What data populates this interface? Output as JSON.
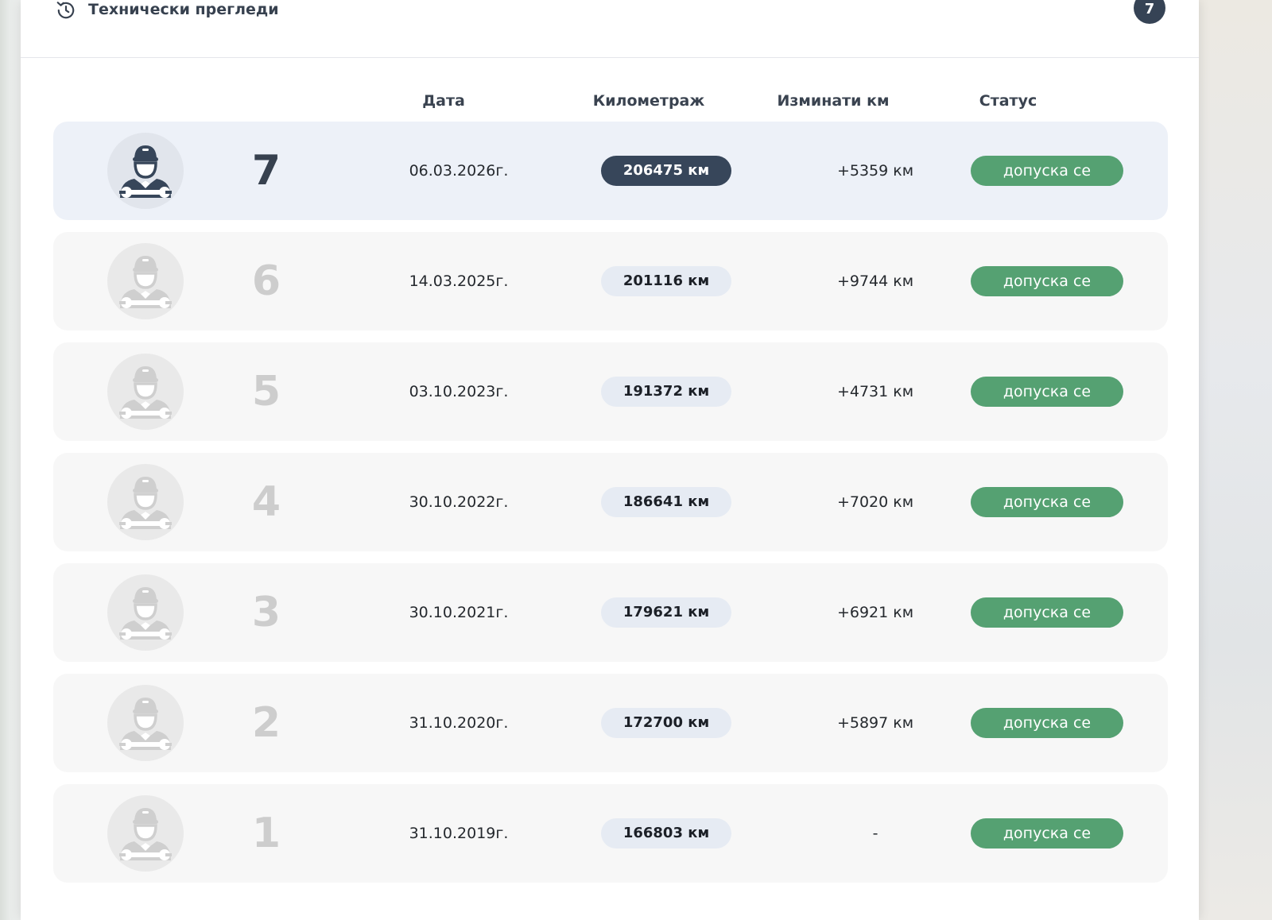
{
  "header": {
    "title": "Технически прегледи",
    "count": "7",
    "icon": "history-icon"
  },
  "columns": {
    "date": "Дата",
    "mileage": "Километраж",
    "driven": "Изминати км",
    "status": "Статус"
  },
  "rows": [
    {
      "number": "7",
      "date": "06.03.2026г.",
      "mileage": "206475 км",
      "driven": "+5359 км",
      "status": "допуска се",
      "active": true
    },
    {
      "number": "6",
      "date": "14.03.2025г.",
      "mileage": "201116 км",
      "driven": "+9744 км",
      "status": "допуска се",
      "active": false
    },
    {
      "number": "5",
      "date": "03.10.2023г.",
      "mileage": "191372 км",
      "driven": "+4731 км",
      "status": "допуска се",
      "active": false
    },
    {
      "number": "4",
      "date": "30.10.2022г.",
      "mileage": "186641 км",
      "driven": "+7020 км",
      "status": "допуска се",
      "active": false
    },
    {
      "number": "3",
      "date": "30.10.2021г.",
      "mileage": "179621 км",
      "driven": "+6921 км",
      "status": "допуска се",
      "active": false
    },
    {
      "number": "2",
      "date": "31.10.2020г.",
      "mileage": "172700 км",
      "driven": "+5897 км",
      "status": "допуска се",
      "active": false
    },
    {
      "number": "1",
      "date": "31.10.2019г.",
      "mileage": "166803 км",
      "driven": "-",
      "status": "допуска се",
      "active": false
    }
  ],
  "colors": {
    "accent_dark": "#37465a",
    "status_green": "#55a172",
    "active_row": "#edf1f8",
    "inactive_row": "#f7f7f7"
  },
  "row_icon": "mechanic-icon"
}
